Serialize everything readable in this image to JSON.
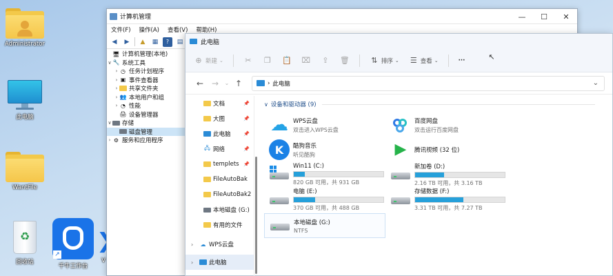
{
  "desktop": {
    "icons": [
      {
        "label": "Administrator"
      },
      {
        "label": "此电脑"
      },
      {
        "label": "WantFile"
      },
      {
        "label": "回收站"
      },
      {
        "label": "千牛工作台"
      },
      {
        "label": "V"
      }
    ]
  },
  "mmc": {
    "title": "计算机管理",
    "controls": {
      "minimize": "—",
      "maximize": "☐",
      "close": "✕"
    },
    "menu": [
      "文件(F)",
      "操作(A)",
      "查看(V)",
      "帮助(H)"
    ],
    "tree": [
      {
        "label": "计算机管理(本地)"
      },
      {
        "label": "系统工具"
      },
      {
        "label": "任务计划程序"
      },
      {
        "label": "事件查看器"
      },
      {
        "label": "共享文件夹"
      },
      {
        "label": "本地用户和组"
      },
      {
        "label": "性能"
      },
      {
        "label": "设备管理器"
      },
      {
        "label": "存储"
      },
      {
        "label": "磁盘管理"
      },
      {
        "label": "服务和应用程序"
      }
    ]
  },
  "explorer": {
    "title": "此电脑",
    "controls": {
      "minimize": "—",
      "maximize": "☐",
      "close": "✕"
    },
    "commands": {
      "new": "新建",
      "sort": "排序",
      "view": "查看",
      "more": "···"
    },
    "address": {
      "path": "此电脑"
    },
    "nav": [
      {
        "label": "文档",
        "pinned": true
      },
      {
        "label": "大图",
        "pinned": true
      },
      {
        "label": "此电脑",
        "pinned": true
      },
      {
        "label": "网络",
        "pinned": true
      },
      {
        "label": "templets",
        "pinned": true
      },
      {
        "label": "FileAutoBak",
        "pinned": false
      },
      {
        "label": "FileAutoBak2",
        "pinned": false
      },
      {
        "label": "本地磁盘 (G:)",
        "pinned": false
      },
      {
        "label": "有用的文件",
        "pinned": false
      },
      {
        "label": "WPS云盘",
        "pinned": false
      },
      {
        "label": "此电脑",
        "pinned": false
      }
    ],
    "section_title": "设备和驱动器 (9)",
    "items": [
      {
        "name": "WPS云盘",
        "sub": "双击进入WPS云盘"
      },
      {
        "name": "百度网盘",
        "sub": "双击运行百度网盘"
      },
      {
        "name": "酷狗音乐",
        "sub": "听见酷狗"
      },
      {
        "name": "腾讯视频 (32 位)",
        "sub": ""
      },
      {
        "name": "Win11 (C:)",
        "sub": "820 GB 可用，共 931 GB",
        "used": 0.12
      },
      {
        "name": "新加卷 (D:)",
        "sub": "2.16 TB 可用，共 3.16 TB",
        "used": 0.32
      },
      {
        "name": "电脑 (E:)",
        "sub": "370 GB 可用，共 488 GB",
        "used": 0.24
      },
      {
        "name": "存储数据 (F:)",
        "sub": "3.31 TB 可用，共 7.27 TB",
        "used": 0.54
      },
      {
        "name": "本地磁盘 (G:)",
        "sub": "NTFS"
      }
    ],
    "colors": {
      "accent": "#26a0da",
      "section": "#1f4e8a"
    }
  }
}
